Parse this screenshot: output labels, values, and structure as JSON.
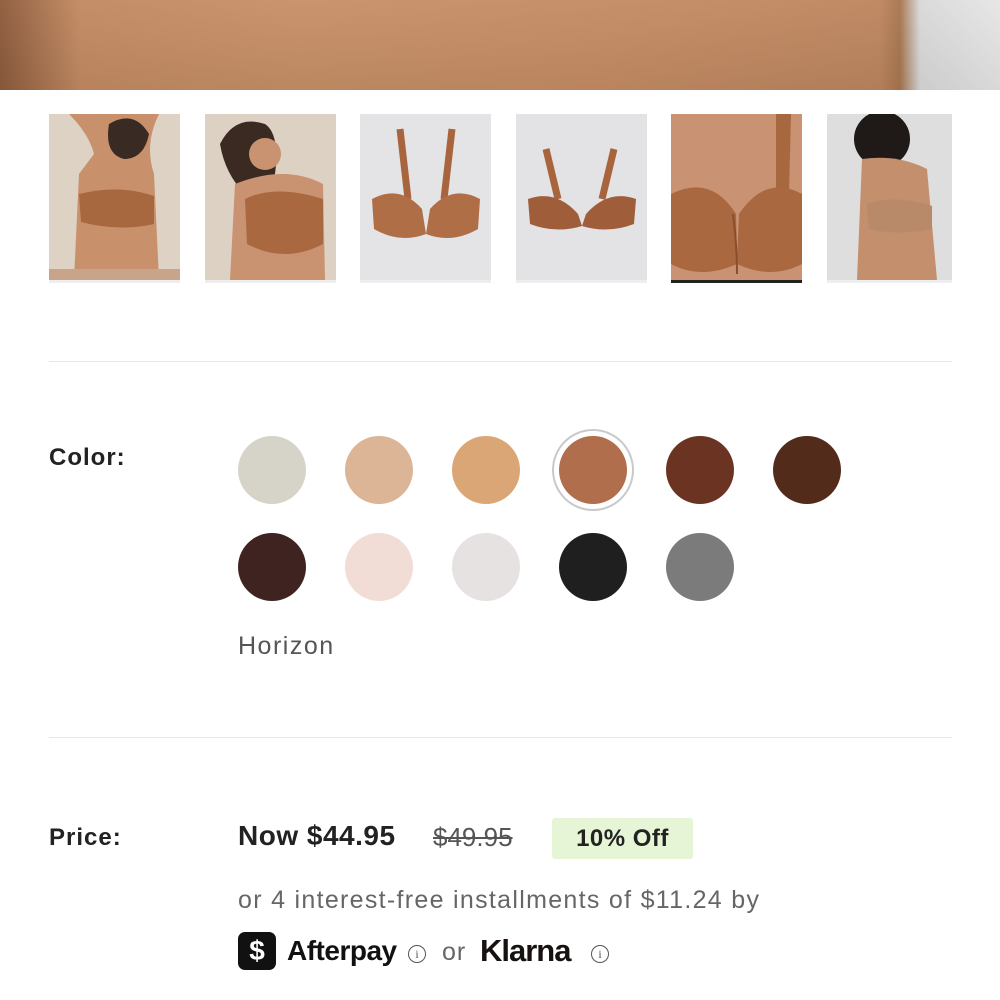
{
  "product": {
    "hero_image": "product-hero-image",
    "thumbnails": [
      {
        "name": "thumb-model-back",
        "alt": "model back view"
      },
      {
        "name": "thumb-model-front",
        "alt": "model front view"
      },
      {
        "name": "thumb-bra-front",
        "alt": "bra front flat"
      },
      {
        "name": "thumb-bra-back",
        "alt": "bra back flat"
      },
      {
        "name": "thumb-closeup",
        "alt": "closeup"
      },
      {
        "name": "thumb-model-side",
        "alt": "model side view"
      }
    ],
    "active_thumbnail_index": 4
  },
  "color": {
    "label": "Color:",
    "selected_name": "Horizon",
    "swatches": [
      {
        "hex": "#7a8b5e"
      },
      {
        "hex": "#d6d4c8"
      },
      {
        "hex": "#dcb596"
      },
      {
        "hex": "#dba676"
      },
      {
        "hex": "#b06e4d",
        "selected": true
      },
      {
        "hex": "#6b3422"
      },
      {
        "hex": "#532b1b"
      },
      {
        "hex": "#3f2320"
      },
      {
        "hex": "#f1ddd5"
      },
      {
        "hex": "#e7e2e2"
      },
      {
        "hex": "#1f1f1f"
      },
      {
        "hex": "#7b7b7b"
      }
    ]
  },
  "price": {
    "label": "Price:",
    "now": "Now $44.95",
    "was": "$49.95",
    "badge": "10% Off",
    "installments": "or 4 interest-free installments of $11.24 by",
    "afterpay_symbol": "$",
    "afterpay": "Afterpay",
    "info_glyph": "i",
    "or": "or",
    "klarna": "Klarna"
  }
}
